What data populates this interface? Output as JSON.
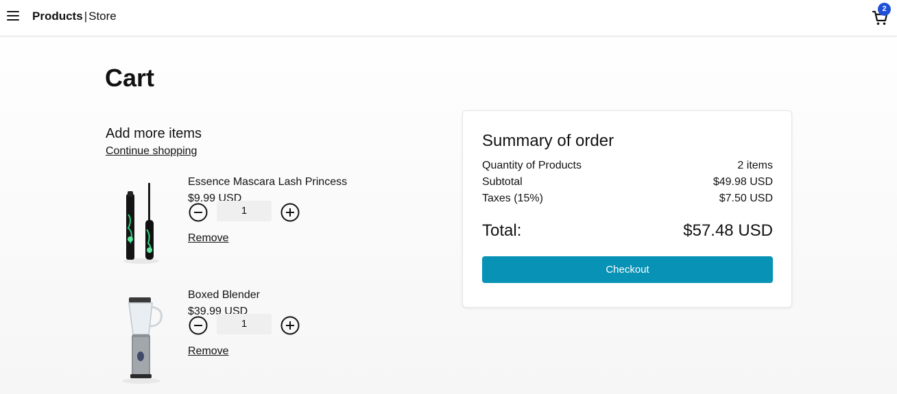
{
  "header": {
    "brand_bold": "Products",
    "brand_separator": "|",
    "brand_rest": "Store",
    "cart_count": "2"
  },
  "page": {
    "title": "Cart",
    "add_more": "Add more items",
    "continue_shopping": "Continue shopping"
  },
  "items": [
    {
      "name": "Essence Mascara Lash Princess",
      "price": "$9.99 USD",
      "quantity": "1",
      "remove_label": "Remove",
      "image_icon": "mascara-product-image"
    },
    {
      "name": "Boxed Blender",
      "price": "$39.99 USD",
      "quantity": "1",
      "remove_label": "Remove",
      "image_icon": "blender-product-image"
    }
  ],
  "summary": {
    "title": "Summary of order",
    "quantity_label": "Quantity of Products",
    "quantity_value": "2 items",
    "subtotal_label": "Subtotal",
    "subtotal_value": "$49.98 USD",
    "taxes_label": "Taxes (15%)",
    "taxes_value": "$7.50 USD",
    "total_label": "Total:",
    "total_value": "$57.48 USD",
    "checkout_label": "Checkout"
  },
  "colors": {
    "accent": "#0892b5",
    "badge": "#1f4fd8"
  }
}
